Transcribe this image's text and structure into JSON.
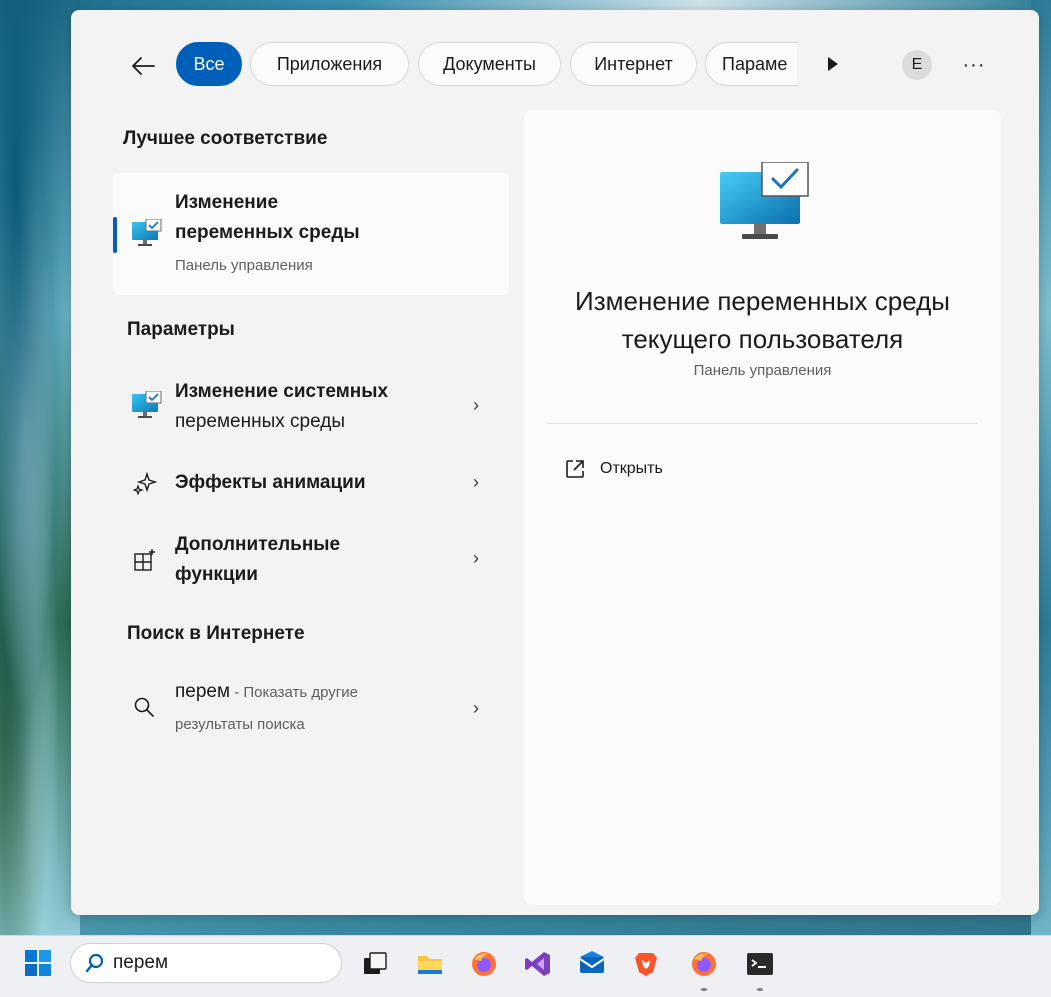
{
  "taskbar": {
    "search_value": "перем",
    "icons": [
      "task-view-icon",
      "file-explorer-icon",
      "firefox-icon",
      "visual-studio-icon",
      "mail-icon",
      "brave-icon",
      "firefox-icon",
      "terminal-icon"
    ]
  },
  "filters": {
    "items": [
      "Все",
      "Приложения",
      "Документы",
      "Интернет",
      "Параме"
    ],
    "active": "Все",
    "avatar_letter": "E",
    "more_label": "···"
  },
  "left": {
    "best_match_heading": "Лучшее соответствие",
    "best_match": {
      "title_line1": "Изменение",
      "title_line2": "переменных среды",
      "subtitle": "Панель управления"
    },
    "settings_heading": "Параметры",
    "settings": [
      {
        "line1": "Изменение системных",
        "line2": "переменных среды"
      },
      {
        "line1": "Эффекты анимации",
        "line2": ""
      },
      {
        "line1": "Дополнительные",
        "line2": "функции"
      }
    ],
    "web_heading": "Поиск в Интернете",
    "web": {
      "query": "перем",
      "hint_part1": " - Показать другие",
      "hint_part2": "результаты поиска"
    },
    "chevron": "›"
  },
  "detail": {
    "title_line1": "Изменение переменных среды",
    "title_line2": "текущего пользователя",
    "subtitle": "Панель управления",
    "open_label": "Открыть"
  },
  "colors": {
    "accent": "#005fb8",
    "panel": "#f3f3f3",
    "card": "#fbfbfb"
  }
}
